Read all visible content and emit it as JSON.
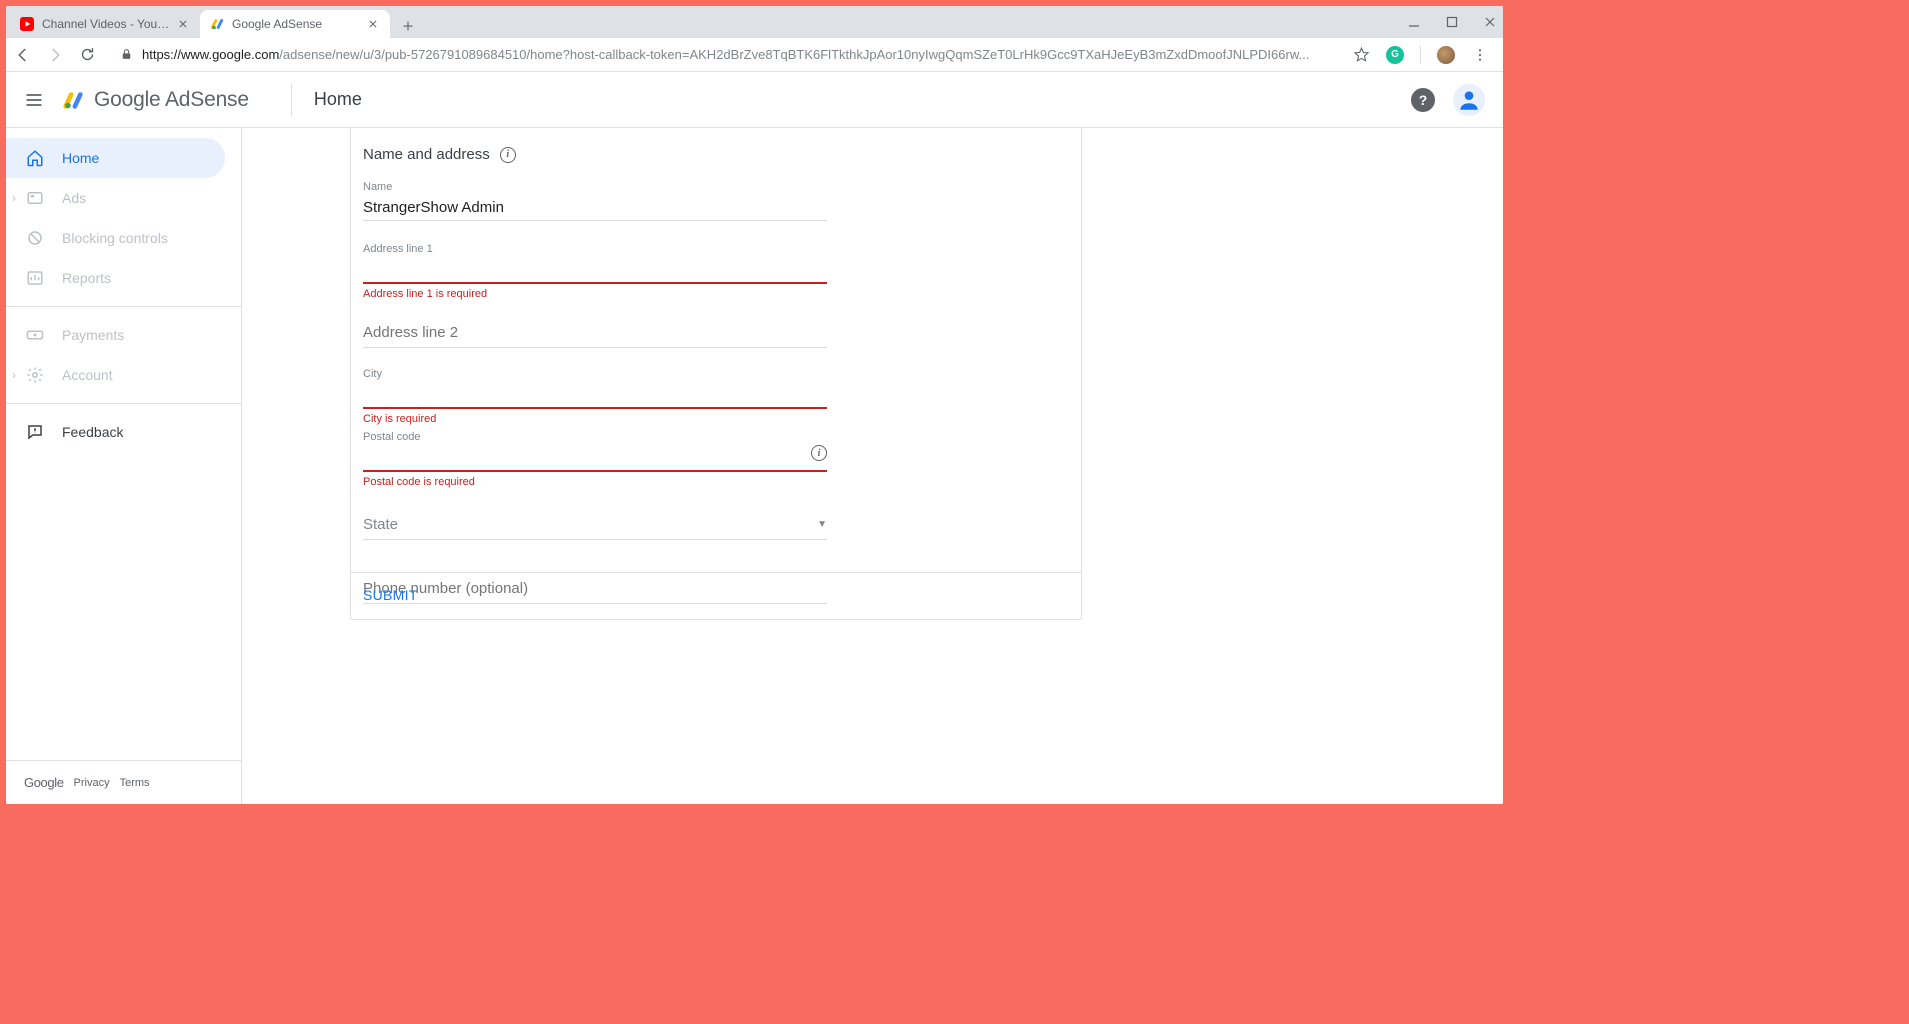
{
  "browser": {
    "tabs": [
      {
        "title": "Channel Videos - YouTube Studio",
        "active": false
      },
      {
        "title": "Google AdSense",
        "active": true
      }
    ],
    "url_host": "https://www.google.com",
    "url_path": "/adsense/new/u/3/pub-5726791089684510/home?host-callback-token=AKH2dBrZve8TqBTK6FlTkthkJpAor10nyIwgQqmSZeT0LrHk9Gcc9TXaHJeEyB3mZxdDmoofJNLPDI66rw..."
  },
  "header": {
    "brand": "Google AdSense",
    "page_title": "Home"
  },
  "sidebar": {
    "items": [
      {
        "label": "Home"
      },
      {
        "label": "Ads"
      },
      {
        "label": "Blocking controls"
      },
      {
        "label": "Reports"
      },
      {
        "label": "Payments"
      },
      {
        "label": "Account"
      },
      {
        "label": "Feedback"
      }
    ],
    "footer": {
      "google": "Google",
      "privacy": "Privacy",
      "terms": "Terms"
    }
  },
  "form": {
    "section_title": "Name and address",
    "name_label": "Name",
    "name_value": "StrangerShow Admin",
    "addr1_label": "Address line 1",
    "addr1_error": "Address line 1 is required",
    "addr2_placeholder": "Address line 2",
    "city_label": "City",
    "city_error": "City is required",
    "postal_label": "Postal code",
    "postal_error": "Postal code is required",
    "state_placeholder": "State",
    "phone_placeholder": "Phone number (optional)",
    "submit_label": "SUBMIT"
  }
}
